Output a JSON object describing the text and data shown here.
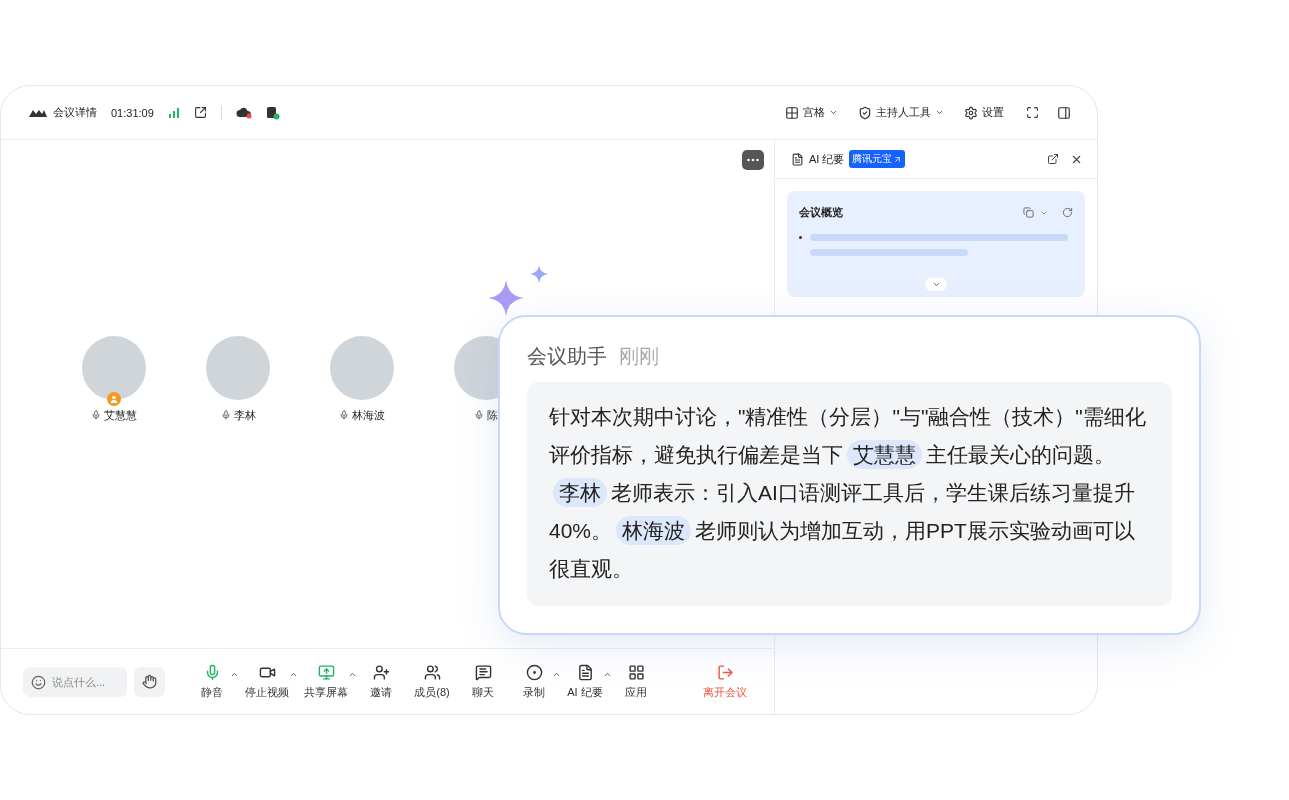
{
  "topbar": {
    "title": "会议详情",
    "timer": "01:31:09",
    "right": [
      {
        "kind": "grid",
        "label": "宫格",
        "caret": true
      },
      {
        "kind": "host",
        "label": "主持人工具",
        "caret": true
      },
      {
        "kind": "settings",
        "label": "设置",
        "caret": false
      }
    ]
  },
  "participants": [
    {
      "name": "艾慧慧",
      "host": true
    },
    {
      "name": "李林",
      "host": false
    },
    {
      "name": "林海波",
      "host": false
    },
    {
      "name": "陈",
      "host": false
    }
  ],
  "chat": {
    "placeholder": "说点什么..."
  },
  "toolbar": [
    {
      "kind": "mic",
      "label": "静音",
      "caret": true
    },
    {
      "kind": "video",
      "label": "停止视频",
      "caret": true
    },
    {
      "kind": "share",
      "label": "共享屏幕",
      "caret": true
    },
    {
      "kind": "invite",
      "label": "邀请",
      "caret": false
    },
    {
      "kind": "members",
      "label": "成员(8)",
      "caret": false
    },
    {
      "kind": "chat",
      "label": "聊天",
      "caret": false
    },
    {
      "kind": "record",
      "label": "录制",
      "caret": true
    },
    {
      "kind": "ai",
      "label": "AI 纪要",
      "caret": true
    },
    {
      "kind": "apps",
      "label": "应用",
      "caret": false
    },
    {
      "kind": "leave",
      "label": "离开会议",
      "caret": false
    }
  ],
  "panel": {
    "title": "AI 纪要",
    "badge": "腾讯元宝",
    "card_title": "会议概览"
  },
  "assistant": {
    "title": "会议助手",
    "time": "刚刚",
    "segments": [
      {
        "text": "针对本次期中讨论，\"精准性（分层）\"与\"融合性（技术）\"需细化评价指标，避免执行偏差是当下",
        "mention": false
      },
      {
        "text": "艾慧慧",
        "mention": true
      },
      {
        "text": "主任最关心的问题。",
        "mention": false
      },
      {
        "text": "李林",
        "mention": true
      },
      {
        "text": "老师表示：引入AI口语测评工具后，学生课后练习量提升40%。",
        "mention": false
      },
      {
        "text": "林海波",
        "mention": true
      },
      {
        "text": "老师则认为增加互动，用PPT展示实验动画可以很直观。",
        "mention": false
      }
    ]
  }
}
